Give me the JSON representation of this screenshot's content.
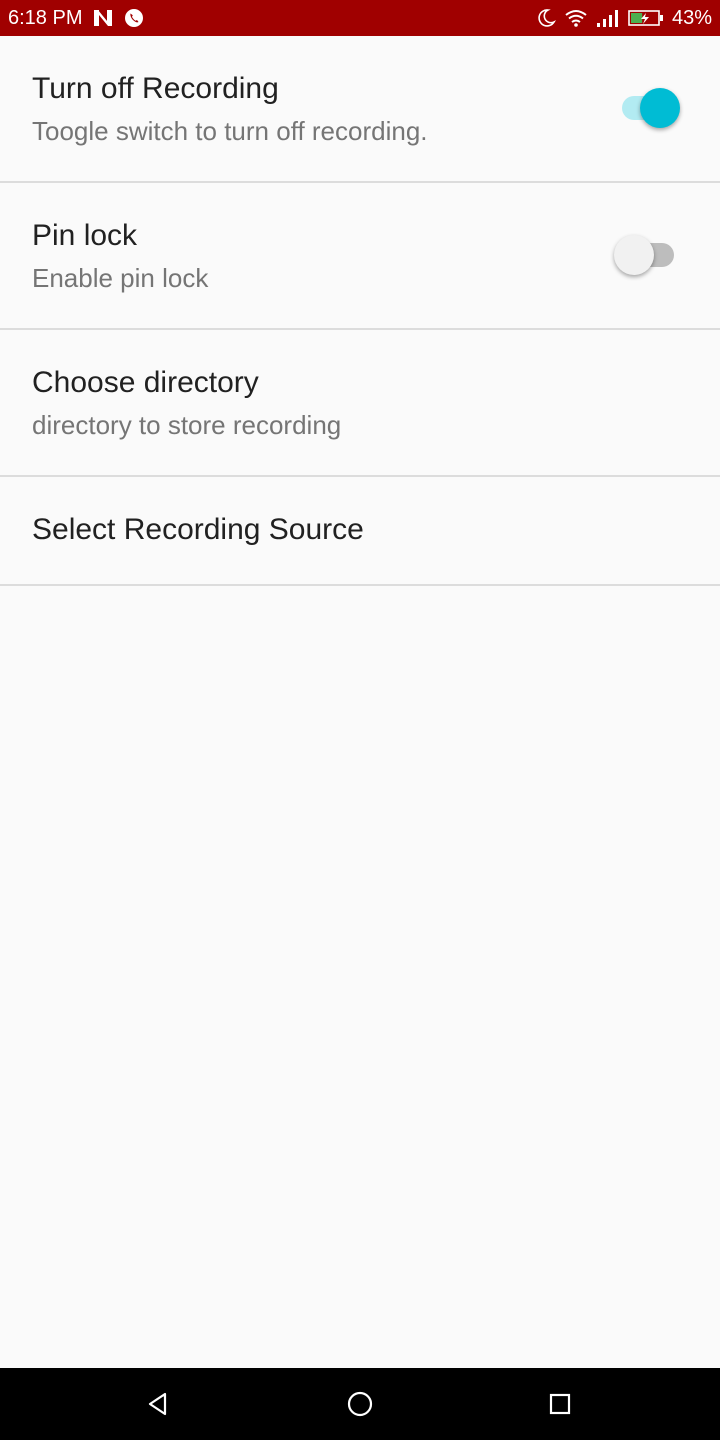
{
  "status_bar": {
    "time": "6:18 PM",
    "battery_percent": "43%",
    "background_color": "#a00000",
    "left_icons": [
      "n-logo-icon",
      "phone-call-icon"
    ],
    "right_icons": [
      "moon-icon",
      "wifi-icon",
      "signal-icon",
      "battery-charging-icon"
    ],
    "battery_level": 0.43
  },
  "settings": {
    "items": [
      {
        "title": "Turn off Recording",
        "summary": "Toogle switch to turn off recording.",
        "switch_on": true
      },
      {
        "title": "Pin lock",
        "summary": "Enable pin lock",
        "switch_on": false
      },
      {
        "title": "Choose directory",
        "summary": "directory to store recording"
      },
      {
        "title": "Select Recording Source"
      }
    ],
    "accent_color": "#00bcd4"
  },
  "nav_bar": {
    "buttons": [
      "back-icon",
      "home-icon",
      "recents-icon"
    ]
  }
}
